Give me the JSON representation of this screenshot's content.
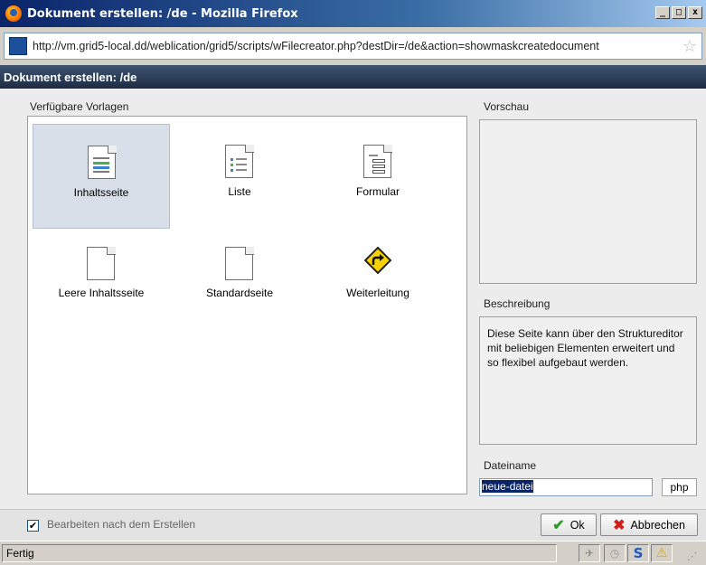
{
  "window": {
    "title": "Dokument erstellen: /de - Mozilla Firefox",
    "minimize_glyph": "_",
    "maximize_glyph": "□",
    "close_glyph": "x"
  },
  "url_bar": {
    "url": "http://vm.grid5-local.dd/weblication/grid5/scripts/wFilecreator.php?destDir=/de&action=showmaskcreatedocument"
  },
  "dialog": {
    "title": "Dokument erstellen: /de",
    "templates_heading": "Verfügbare Vorlagen",
    "preview_heading": "Vorschau",
    "description_heading": "Beschreibung",
    "description_text": "Diese Seite kann über den Strukturedit­or mit beliebigen Elementen erweitert und so flexibel aufgebaut werden.",
    "filename_heading": "Dateiname",
    "filename_value": "neue-datei",
    "extension": "php"
  },
  "templates": [
    {
      "label": "Inhaltsseite",
      "icon": "content-page-icon",
      "selected": true
    },
    {
      "label": "Liste",
      "icon": "list-page-icon",
      "selected": false
    },
    {
      "label": "Formular",
      "icon": "form-page-icon",
      "selected": false
    },
    {
      "label": "Leere Inhaltsseite",
      "icon": "blank-page-icon",
      "selected": false
    },
    {
      "label": "Standardseite",
      "icon": "blank-page-icon",
      "selected": false
    },
    {
      "label": "Weiterleitung",
      "icon": "redirect-sign-icon",
      "selected": false
    }
  ],
  "footer": {
    "edit_after_create_label": "Bearbeiten nach dem Erstellen",
    "edit_after_create_checked": true,
    "ok_label": "Ok",
    "cancel_label": "Abbrechen"
  },
  "statusbar": {
    "text": "Fertig"
  },
  "colors": {
    "header_bg": "#1d2c44",
    "selected_tile": "#d9dfe8",
    "ok_green": "#2d9c2d",
    "cancel_red": "#d0201b"
  }
}
